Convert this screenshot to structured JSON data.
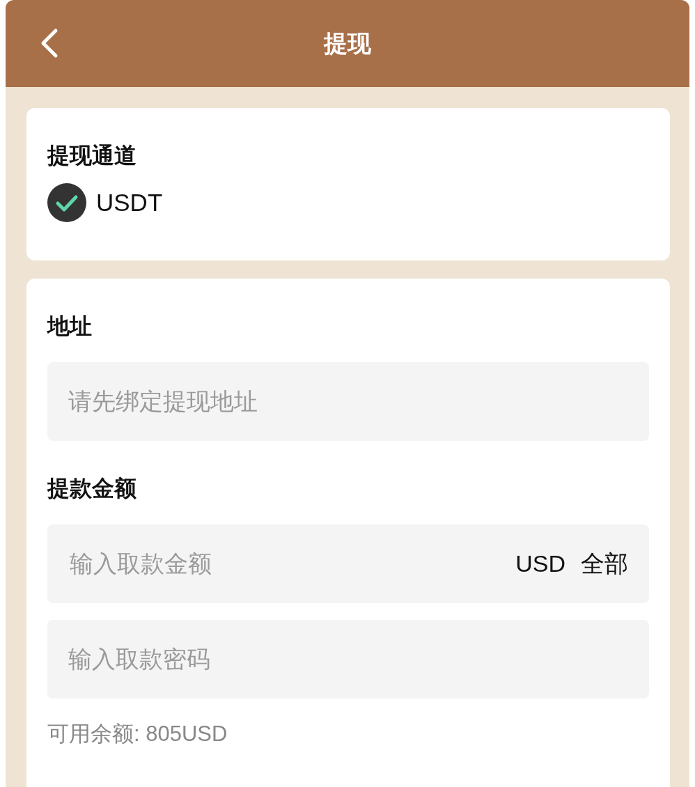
{
  "header": {
    "title": "提现"
  },
  "channel": {
    "label": "提现通道",
    "options": [
      {
        "label": "USDT",
        "selected": true
      }
    ]
  },
  "address": {
    "label": "地址",
    "field": {
      "placeholder": "请先绑定提现地址"
    }
  },
  "amount": {
    "label": "提款金额",
    "field": {
      "placeholder": "输入取款金额",
      "unit": "USD",
      "all_button": "全部"
    },
    "password_field": {
      "placeholder": "输入取款密码"
    },
    "balance": "可用余额: 805USD"
  }
}
